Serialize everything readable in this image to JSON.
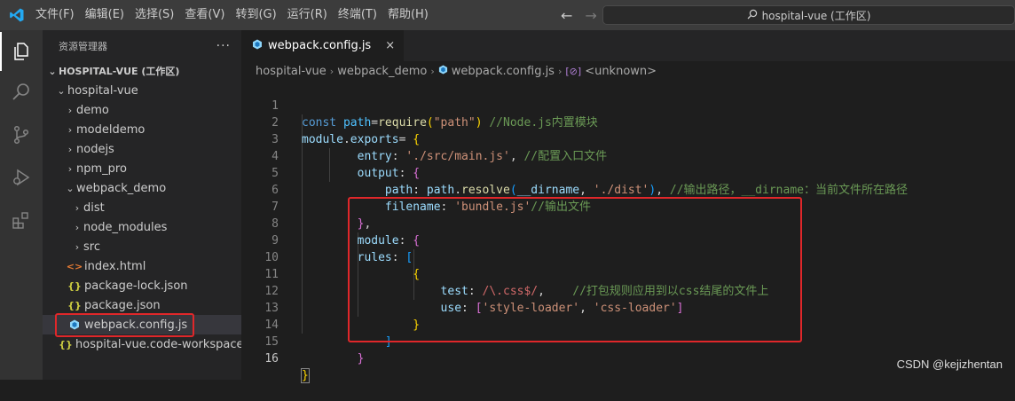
{
  "menu": [
    "文件(F)",
    "编辑(E)",
    "选择(S)",
    "查看(V)",
    "转到(G)",
    "运行(R)",
    "终端(T)",
    "帮助(H)"
  ],
  "search": {
    "text": "hospital-vue (工作区)"
  },
  "sidebar": {
    "title": "资源管理器",
    "more": "···",
    "workspace": "HOSPITAL-VUE (工作区)",
    "items": [
      {
        "label": "hospital-vue",
        "type": "folder-open"
      },
      {
        "label": "demo",
        "type": "folder"
      },
      {
        "label": "modeldemo",
        "type": "folder"
      },
      {
        "label": "nodejs",
        "type": "folder"
      },
      {
        "label": "npm_pro",
        "type": "folder"
      },
      {
        "label": "webpack_demo",
        "type": "folder-open"
      },
      {
        "label": "dist",
        "type": "folder"
      },
      {
        "label": "node_modules",
        "type": "folder"
      },
      {
        "label": "src",
        "type": "folder"
      },
      {
        "label": "index.html",
        "type": "html",
        "icon": "<>"
      },
      {
        "label": "package-lock.json",
        "type": "json",
        "icon": "{}"
      },
      {
        "label": "package.json",
        "type": "json",
        "icon": "{}"
      },
      {
        "label": "webpack.config.js",
        "type": "webpack"
      },
      {
        "label": "hospital-vue.code-workspace",
        "type": "json",
        "icon": "{}"
      }
    ]
  },
  "tab": {
    "label": "webpack.config.js",
    "close": "×"
  },
  "breadcrumb": [
    "hospital-vue",
    "webpack_demo",
    "webpack.config.js",
    "<unknown>"
  ],
  "code": {
    "line_numbers": [
      "1",
      "2",
      "3",
      "4",
      "5",
      "6",
      "7",
      "8",
      "9",
      "10",
      "11",
      "12",
      "13",
      "14",
      "15",
      "16"
    ]
  },
  "watermark": "CSDN @kejizhentan",
  "colors": {
    "highlight_box": "#e0272a",
    "accent": "#0078d4"
  }
}
